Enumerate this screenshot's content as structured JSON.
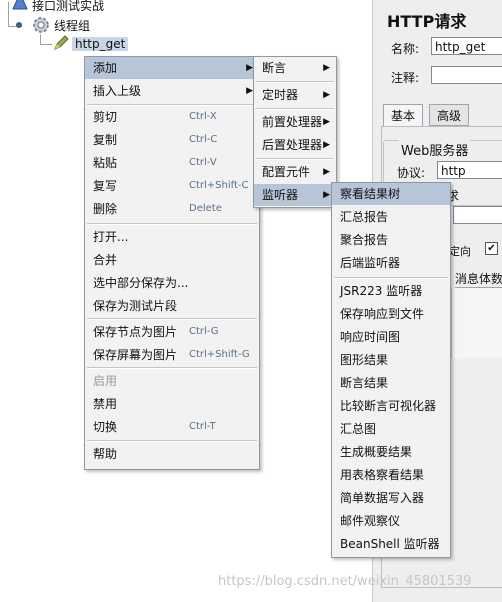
{
  "tree": {
    "root_label": "接口测试实战",
    "thread_group_label": "线程组",
    "sampler_label": "http_get"
  },
  "panel": {
    "title": "HTTP请求",
    "name_label": "名称:",
    "name_value": "http_get",
    "comment_label": "注释:",
    "comment_value": "",
    "tab_basic": "基本",
    "tab_advanced": "高级",
    "web_server_label": "Web服务器",
    "protocol_label": "协议:",
    "protocol_value": "http",
    "partial_text_1": "定向",
    "partial_text_2": "消息体数",
    "partial_text_3": "求"
  },
  "context_menu": {
    "items": [
      {
        "label": "添加",
        "shortcut": "",
        "submenu": true,
        "highlighted": true
      },
      {
        "label": "插入上级",
        "shortcut": "",
        "submenu": true
      },
      {
        "label": "剪切",
        "shortcut": "Ctrl-X"
      },
      {
        "label": "复制",
        "shortcut": "Ctrl-C"
      },
      {
        "label": "粘贴",
        "shortcut": "Ctrl-V"
      },
      {
        "label": "复写",
        "shortcut": "Ctrl+Shift-C"
      },
      {
        "label": "删除",
        "shortcut": "Delete"
      },
      {
        "label": "打开...",
        "shortcut": ""
      },
      {
        "label": "合并",
        "shortcut": ""
      },
      {
        "label": "选中部分保存为...",
        "shortcut": ""
      },
      {
        "label": "保存为测试片段",
        "shortcut": ""
      },
      {
        "label": "保存节点为图片",
        "shortcut": "Ctrl-G"
      },
      {
        "label": "保存屏幕为图片",
        "shortcut": "Ctrl+Shift-G"
      },
      {
        "label": "启用",
        "shortcut": "",
        "disabled": true
      },
      {
        "label": "禁用",
        "shortcut": ""
      },
      {
        "label": "切换",
        "shortcut": "Ctrl-T"
      },
      {
        "label": "帮助",
        "shortcut": ""
      }
    ]
  },
  "add_submenu": {
    "items": [
      {
        "label": "断言",
        "submenu": true
      },
      {
        "label": "定时器",
        "submenu": true
      },
      {
        "label": "前置处理器",
        "submenu": true
      },
      {
        "label": "后置处理器",
        "submenu": true
      },
      {
        "label": "配置元件",
        "submenu": true
      },
      {
        "label": "监听器",
        "submenu": true,
        "highlighted": true
      }
    ]
  },
  "listener_submenu": {
    "items": [
      {
        "label": "察看结果树",
        "highlighted": true
      },
      {
        "label": "汇总报告"
      },
      {
        "label": "聚合报告"
      },
      {
        "label": "后端监听器"
      },
      {
        "label": "JSR223 监听器"
      },
      {
        "label": "保存响应到文件"
      },
      {
        "label": "响应时间图"
      },
      {
        "label": "图形结果"
      },
      {
        "label": "断言结果"
      },
      {
        "label": "比较断言可视化器"
      },
      {
        "label": "汇总图"
      },
      {
        "label": "生成概要结果"
      },
      {
        "label": "用表格察看结果"
      },
      {
        "label": "简单数据写入器"
      },
      {
        "label": "邮件观察仪"
      },
      {
        "label": "BeanShell 监听器"
      }
    ]
  },
  "watermark": "https://blog.csdn.net/weixin_45801539",
  "colors": {
    "menu_bg": "#f2f2f2",
    "highlight": "#b7c5d8",
    "shortcut_text": "#5a6f8a"
  }
}
